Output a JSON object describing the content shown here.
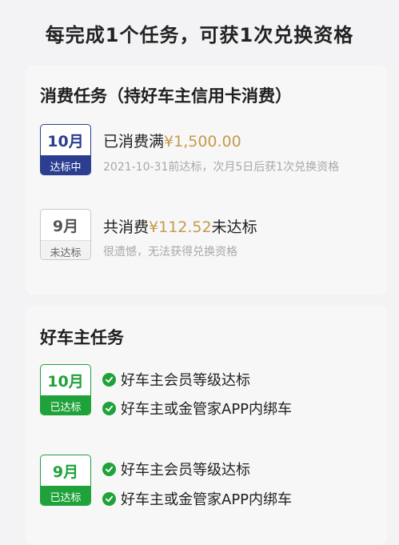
{
  "header": {
    "title": "每完成1个任务，可获1次兑换资格"
  },
  "consumption": {
    "title": "消费任务（持好车主信用卡消费）",
    "items": [
      {
        "month": "10月",
        "status": "达标中",
        "main_prefix": "已消费满",
        "amount": "¥1,500.00",
        "main_suffix": "",
        "sub": "2021-10-31前达标，次月5日后获1次兑换资格"
      },
      {
        "month": "9月",
        "status": "未达标",
        "main_prefix": "共消费",
        "amount": "¥112.52",
        "main_suffix": "未达标",
        "sub": "很遗憾，无法获得兑换资格"
      }
    ]
  },
  "owner_tasks": {
    "title": "好车主任务",
    "items": [
      {
        "month": "10月",
        "status": "已达标",
        "checks": [
          "好车主会员等级达标",
          "好车主或金管家APP内绑车"
        ]
      },
      {
        "month": "9月",
        "status": "已达标",
        "checks": [
          "好车主会员等级达标",
          "好车主或金管家APP内绑车"
        ]
      }
    ]
  },
  "colors": {
    "in_progress": "#2b3e8f",
    "achieved": "#1fa23a",
    "amount": "#c69a4c",
    "not_achieved": "#c9c9c9"
  },
  "icons": {
    "check": "check-circle-icon"
  }
}
